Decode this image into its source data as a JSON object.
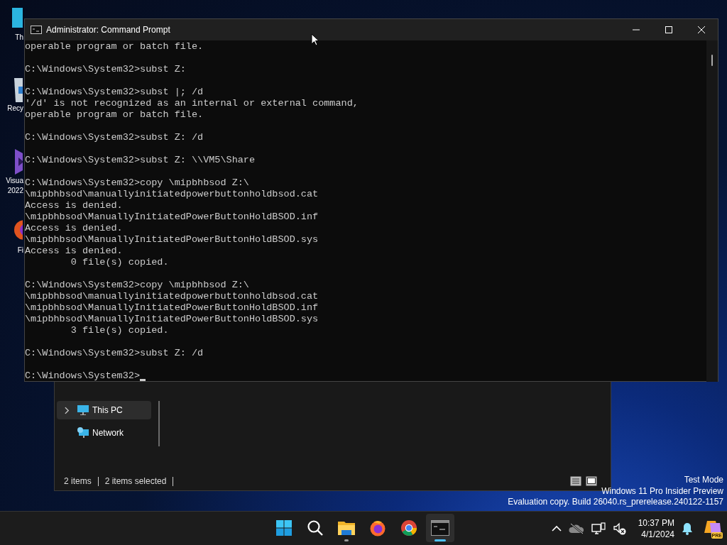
{
  "desktop_icons": [
    {
      "kind": "monitor",
      "lines": [
        "Th"
      ]
    },
    {
      "kind": "recycle-bin",
      "lines": [
        "Recy"
      ]
    },
    {
      "kind": "visual-studio",
      "lines": [
        "Visua",
        "2022"
      ]
    },
    {
      "kind": "firefox",
      "lines": [
        "Fi"
      ]
    }
  ],
  "explorer": {
    "nav_items": [
      {
        "label": "This PC",
        "kind": "pc",
        "selected": true,
        "expandable": true
      },
      {
        "label": "Network",
        "kind": "network",
        "selected": false,
        "expandable": false
      }
    ],
    "status": [
      "2 items",
      "2 items selected"
    ],
    "view_buttons": [
      {
        "kind": "details"
      },
      {
        "kind": "tiles"
      }
    ]
  },
  "cmd": {
    "title": "Administrator: Command Prompt",
    "blocks": [
      [
        "operable program or batch file."
      ],
      [
        "C:\\Windows\\System32>subst Z:"
      ],
      [
        "C:\\Windows\\System32>subst |; /d",
        "'/d' is not recognized as an internal or external command,",
        "operable program or batch file."
      ],
      [
        "C:\\Windows\\System32>subst Z: /d"
      ],
      [
        "C:\\Windows\\System32>subst Z: \\\\VM5\\Share"
      ],
      [
        "C:\\Windows\\System32>copy \\mipbhbsod Z:\\",
        "\\mipbhbsod\\manuallyinitiatedpowerbuttonholdbsod.cat",
        "Access is denied.",
        "\\mipbhbsod\\ManuallyInitiatedPowerButtonHoldBSOD.inf",
        "Access is denied.",
        "\\mipbhbsod\\ManuallyInitiatedPowerButtonHoldBSOD.sys",
        "Access is denied.",
        "        0 file(s) copied."
      ],
      [
        "C:\\Windows\\System32>copy \\mipbhbsod Z:\\",
        "\\mipbhbsod\\manuallyinitiatedpowerbuttonholdbsod.cat",
        "\\mipbhbsod\\ManuallyInitiatedPowerButtonHoldBSOD.inf",
        "\\mipbhbsod\\ManuallyInitiatedPowerButtonHoldBSOD.sys",
        "        3 file(s) copied."
      ],
      [
        "C:\\Windows\\System32>subst Z: /d"
      ],
      [
        "C:\\Windows\\System32>"
      ]
    ]
  },
  "watermark_lines": [
    "Test Mode",
    "Windows 11 Pro Insider Preview",
    "Evaluation copy. Build 26040.rs_prerelease.240122-1157"
  ],
  "taskbar": {
    "apps": [
      {
        "kind": "start",
        "running": false,
        "active": false
      },
      {
        "kind": "search",
        "running": false,
        "active": false
      },
      {
        "kind": "file-explorer",
        "running": true,
        "active": false
      },
      {
        "kind": "firefox",
        "running": false,
        "active": false
      },
      {
        "kind": "chrome",
        "running": false,
        "active": false
      },
      {
        "kind": "terminal",
        "running": true,
        "active": true
      }
    ],
    "tray": [
      {
        "kind": "chevron"
      },
      {
        "kind": "cloud-off"
      },
      {
        "kind": "network"
      },
      {
        "kind": "volume-muted"
      }
    ],
    "time": "10:37 PM",
    "date": "4/1/2024",
    "copilot_badge": "PRE"
  }
}
